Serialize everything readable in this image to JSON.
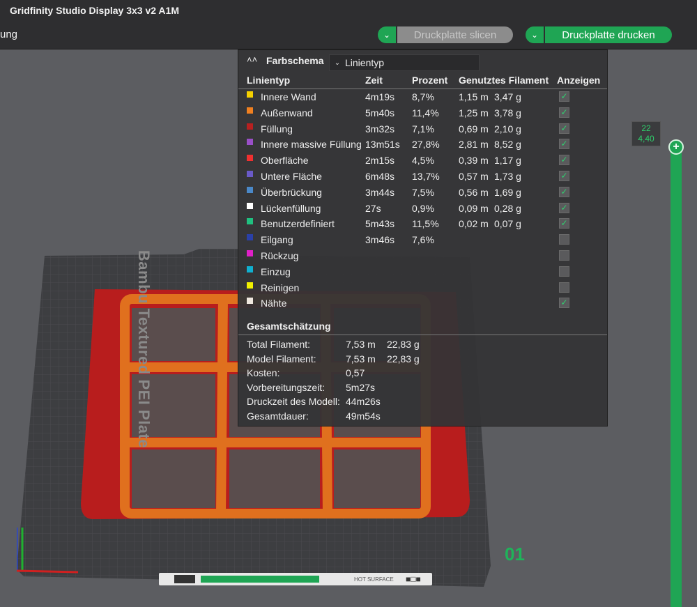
{
  "window": {
    "title": "Gridfinity Studio Display 3x3 v2 A1M",
    "tab_partial": "ung"
  },
  "toolbar": {
    "slice_label": "Druckplatte slicen",
    "print_label": "Druckplatte drucken"
  },
  "colors": {
    "accent": "#1fa554",
    "fill_red": "#b81d1d",
    "wall_orange": "#e0701e"
  },
  "plate": {
    "label": "Bambu Textured PEI Plate",
    "number": "01",
    "hot_surface": "HOT SURFACE"
  },
  "layer_slider": {
    "layer": "22",
    "height": "4,40"
  },
  "legend": {
    "title": "Farbschema",
    "scheme_value": "Linientyp",
    "headers": {
      "type": "Linientyp",
      "time": "Zeit",
      "percent": "Prozent",
      "filament": "Genutztes Filament",
      "show": "Anzeigen"
    },
    "rows": [
      {
        "name": "Innere Wand",
        "color": "#f5d000",
        "time": "4m19s",
        "percent": "8,7%",
        "length": "1,15 m",
        "weight": "3,47 g",
        "shown": true
      },
      {
        "name": "Außenwand",
        "color": "#f08020",
        "time": "5m40s",
        "percent": "11,4%",
        "length": "1,25 m",
        "weight": "3,78 g",
        "shown": true
      },
      {
        "name": "Füllung",
        "color": "#b82020",
        "time": "3m32s",
        "percent": "7,1%",
        "length": "0,69 m",
        "weight": "2,10 g",
        "shown": true
      },
      {
        "name": "Innere massive Füllung",
        "color": "#9a4fc8",
        "time": "13m51s",
        "percent": "27,8%",
        "length": "2,81 m",
        "weight": "8,52 g",
        "shown": true
      },
      {
        "name": "Oberfläche",
        "color": "#f03030",
        "time": "2m15s",
        "percent": "4,5%",
        "length": "0,39 m",
        "weight": "1,17 g",
        "shown": true
      },
      {
        "name": "Untere Fläche",
        "color": "#6a5ac8",
        "time": "6m48s",
        "percent": "13,7%",
        "length": "0,57 m",
        "weight": "1,73 g",
        "shown": true
      },
      {
        "name": "Überbrückung",
        "color": "#4a88c8",
        "time": "3m44s",
        "percent": "7,5%",
        "length": "0,56 m",
        "weight": "1,69 g",
        "shown": true
      },
      {
        "name": "Lückenfüllung",
        "color": "#ffffff",
        "time": "27s",
        "percent": "0,9%",
        "length": "0,09 m",
        "weight": "0,28 g",
        "shown": true
      },
      {
        "name": "Benutzerdefiniert",
        "color": "#20c080",
        "time": "5m43s",
        "percent": "11,5%",
        "length": "0,02 m",
        "weight": "0,07 g",
        "shown": true
      },
      {
        "name": "Eilgang",
        "color": "#2a40a8",
        "time": "3m46s",
        "percent": "7,6%",
        "length": "",
        "weight": "",
        "shown": false
      },
      {
        "name": "Rückzug",
        "color": "#e020c8",
        "time": "",
        "percent": "",
        "length": "",
        "weight": "",
        "shown": false
      },
      {
        "name": "Einzug",
        "color": "#10b0d0",
        "time": "",
        "percent": "",
        "length": "",
        "weight": "",
        "shown": false
      },
      {
        "name": "Reinigen",
        "color": "#f0f000",
        "time": "",
        "percent": "",
        "length": "",
        "weight": "",
        "shown": false
      },
      {
        "name": "Nähte",
        "color": "#f0e8e0",
        "time": "",
        "percent": "",
        "length": "",
        "weight": "",
        "shown": true
      }
    ]
  },
  "summary": {
    "title": "Gesamtschätzung",
    "rows": [
      {
        "label": "Total Filament:",
        "value": "7,53 m",
        "value2": "22,83 g"
      },
      {
        "label": "Model Filament:",
        "value": "7,53 m",
        "value2": "22,83 g"
      },
      {
        "label": "Kosten:",
        "value": "0,57",
        "value2": ""
      },
      {
        "label": "Vorbereitungszeit:",
        "value": "5m27s",
        "value2": ""
      },
      {
        "label": "Druckzeit des Modell:",
        "value": "44m26s",
        "value2": ""
      },
      {
        "label": "Gesamtdauer:",
        "value": "49m54s",
        "value2": ""
      }
    ]
  }
}
